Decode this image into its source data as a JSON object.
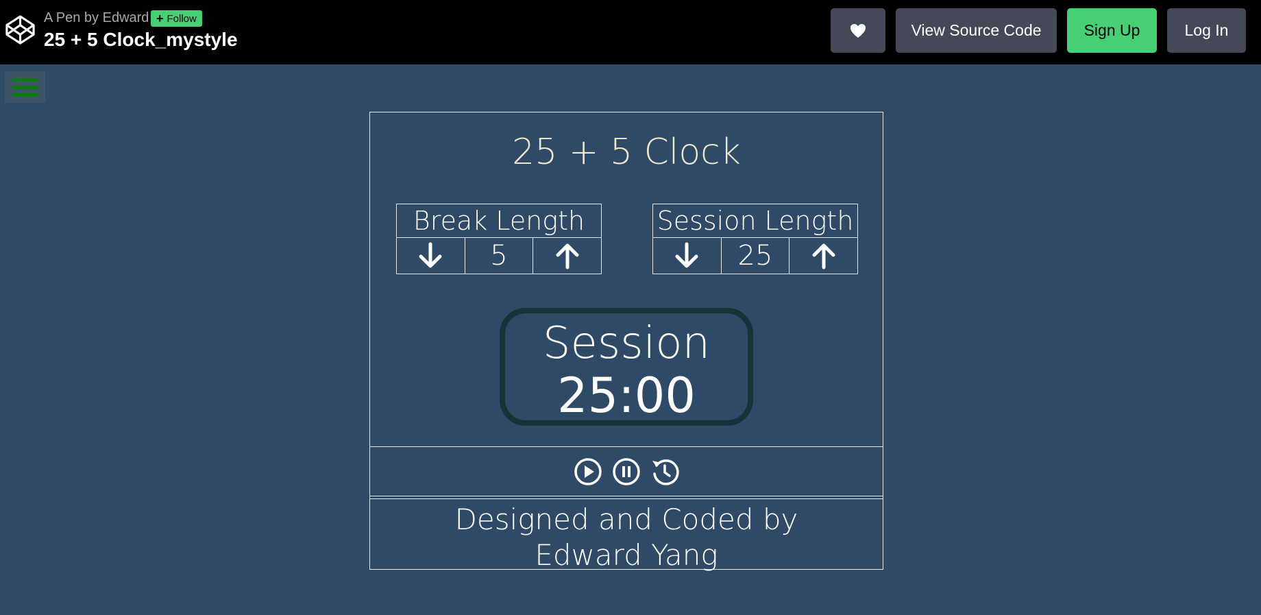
{
  "header": {
    "pen_by": "A Pen by Edward",
    "follow_label": "Follow",
    "title": "25 + 5 Clock_mystyle",
    "view_source_label": "View Source Code",
    "signup_label": "Sign Up",
    "login_label": "Log In",
    "heart_icon": "heart-icon",
    "logo_icon": "codepen-logo"
  },
  "menu": {
    "icon": "hamburger-icon"
  },
  "clock": {
    "title": "25 + 5 Clock",
    "break": {
      "label": "Break Length",
      "value": "5"
    },
    "session": {
      "label": "Session Length",
      "value": "25"
    },
    "timer": {
      "label": "Session",
      "time_left": "25:00"
    },
    "controls": [
      "play-icon",
      "pause-icon",
      "reset-icon"
    ],
    "credit_line1": "Designed and Coded by",
    "credit_line2": "Edward Yang"
  },
  "colors": {
    "background": "#2f4a66",
    "topbar": "#000000",
    "button_gray": "#444857",
    "signup_green": "#47cf73",
    "title_cream": "#efe8cf",
    "timer_border": "#16333a",
    "hamburger_green": "#0c7a0c"
  }
}
